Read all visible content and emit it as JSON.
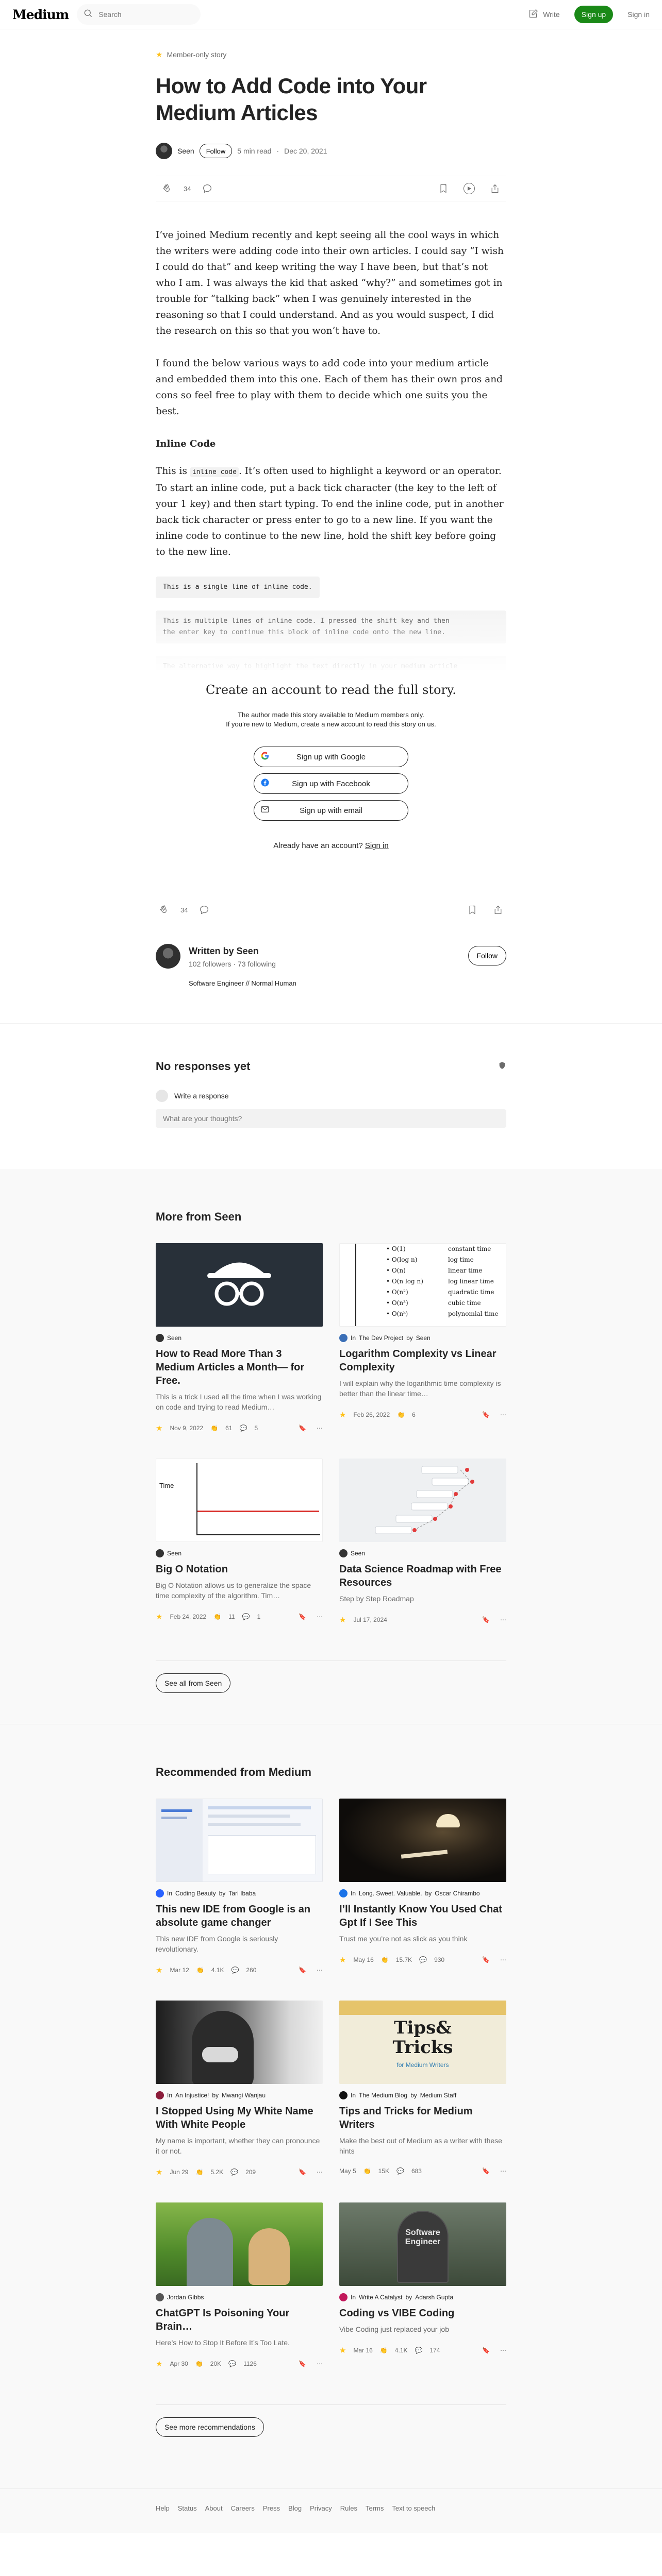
{
  "nav": {
    "logo": "Medium",
    "search_placeholder": "Search",
    "write": "Write",
    "signup": "Sign up",
    "signin": "Sign in"
  },
  "article": {
    "member_only": "Member-only story",
    "title": "How to Add Code into Your Medium Articles",
    "author": "Seen",
    "follow": "Follow",
    "read_time": "5 min read",
    "dot": "·",
    "date": "Dec 20, 2021",
    "claps": "34",
    "p1": "I’ve joined Medium recently and kept seeing all the cool ways in which the writers were adding code into their own articles. I could say “I wish I could do that” and keep writing the way I have been, but that’s not who I am. I was always the kid that asked “why?” and sometimes got in trouble for “talking back” when I was genuinely interested in the reasoning so that I could understand. And as you would suspect, I did the research on this so that you won’t have to.",
    "p2": "I found the below various ways to add code into your medium article and embedded them into this one. Each of them has their own pros and cons so feel free to play with them to decide which one suits you the best.",
    "h_inline": "Inline Code",
    "p3_a": "This is ",
    "p3_code": "inline code",
    "p3_b": ". It’s often used to highlight a keyword or an operator. To start an inline code, put a back tick character (the key to the left of your 1 key) and then start typing. To end the inline code, put in another back tick character or press enter to go to a new line. If you want the inline code to continue to the new line, hold the shift key before going to the new line.",
    "code1": "This is a single line of inline code.",
    "code2a": "This is multiple lines of inline code. I pressed the shift key and then",
    "code2b": "the enter key to continue this block of inline code onto the new line.",
    "code3": "The alternative way to highlight the text directly in your medium article"
  },
  "paywall": {
    "title": "Create an account to read the full story.",
    "sub1": "The author made this story available to Medium members only.",
    "sub2": "If you’re new to Medium, create a new account to read this story on us.",
    "google": "Sign up with Google",
    "facebook": "Sign up with Facebook",
    "email": "Sign up with email",
    "have": "Already have an account?",
    "signin": "Sign in"
  },
  "author_box": {
    "written_by": "Written by Seen",
    "followers": "102 followers",
    "following": "73 following",
    "bio": "Software Engineer // Normal Human",
    "follow": "Follow"
  },
  "responses": {
    "title": "No responses yet",
    "user": "Write a response",
    "placeholder": "What are your thoughts?"
  },
  "more": {
    "title": "More from Seen",
    "cards": [
      {
        "pub": "",
        "in": "",
        "author": "Seen",
        "title": "How to Read More Than 3 Medium Articles a Month— for Free.",
        "desc": "This is a trick I used all the time when I was working on code and trying to read Medium…",
        "date": "Nov 9, 2022",
        "claps": "61",
        "comments": "5"
      },
      {
        "pub": "The Dev Project",
        "in": "In",
        "by": "by",
        "author": "Seen",
        "title": "Logarithm Complexity vs Linear Complexity",
        "desc": "I will explain why the logarithmic time complexity is better than the linear time…",
        "date": "Feb 26, 2022",
        "claps": "6",
        "comments": ""
      },
      {
        "pub": "",
        "in": "",
        "author": "Seen",
        "title": "Big O Notation",
        "desc": "Big O Notation allows us to generalize the space time complexity of the algorithm. Tim…",
        "date": "Feb 24, 2022",
        "claps": "11",
        "comments": "1"
      },
      {
        "pub": "",
        "in": "",
        "author": "Seen",
        "title": "Data Science Roadmap with Free Resources",
        "desc": "Step by Step Roadmap",
        "date": "Jul 17, 2024",
        "claps": "",
        "comments": ""
      }
    ],
    "see_all": "See all from Seen"
  },
  "recommended": {
    "title": "Recommended from Medium",
    "cards": [
      {
        "in": "In",
        "pub": "Coding Beauty",
        "by": "by",
        "author": "Tari Ibaba",
        "title": "This new IDE from Google is an absolute game changer",
        "desc": "This new IDE from Google is seriously revolutionary.",
        "date": "Mar 12",
        "claps": "4.1K",
        "comments": "260"
      },
      {
        "in": "In",
        "pub": "Long. Sweet. Valuable.",
        "by": "by",
        "author": "Oscar Chirambo",
        "title": "I’ll Instantly Know You Used Chat Gpt If I See This",
        "desc": "Trust me you’re not as slick as you think",
        "date": "May 16",
        "claps": "15.7K",
        "comments": "930"
      },
      {
        "in": "In",
        "pub": "An Injustice!",
        "by": "by",
        "author": "Mwangi Wanjau",
        "title": "I Stopped Using My White Name With White People",
        "desc": "My name is important, whether they can pronounce it or not.",
        "date": "Jun 29",
        "claps": "5.2K",
        "comments": "209"
      },
      {
        "in": "In",
        "pub": "The Medium Blog",
        "by": "by",
        "author": "Medium Staff",
        "title": "Tips and Tricks for Medium Writers",
        "desc": "Make the best out of Medium as a writer with these hints",
        "date": "May 5",
        "claps": "15K",
        "comments": "683"
      },
      {
        "in": "",
        "pub": "",
        "by": "",
        "author": "Jordan Gibbs",
        "title": "ChatGPT Is Poisoning Your Brain…",
        "desc": "Here’s How to Stop It Before It’s Too Late.",
        "date": "Apr 30",
        "claps": "20K",
        "comments": "1126"
      },
      {
        "in": "In",
        "pub": "Write A Catalyst",
        "by": "by",
        "author": "Adarsh Gupta",
        "title": "Coding vs VIBE Coding",
        "desc": "Vibe Coding just replaced your job",
        "date": "Mar 16",
        "claps": "4.1K",
        "comments": "174"
      }
    ],
    "see_more": "See more recommendations"
  },
  "img_text": {
    "time": "Time",
    "tips1": "Tips&",
    "tips2": "Tricks",
    "tips3": "for Medium Writers",
    "sw1": "Software",
    "sw2": "Engineer",
    "complexity": [
      [
        "O(1)",
        "constant time"
      ],
      [
        "O(log n)",
        "log time"
      ],
      [
        "O(n)",
        "linear time"
      ],
      [
        "O(n log n)",
        "log linear time"
      ],
      [
        "O(n²)",
        "quadratic time"
      ],
      [
        "O(n³)",
        "cubic time"
      ],
      [
        "O(nᵏ)",
        "polynomial time"
      ]
    ]
  },
  "footer": {
    "links": [
      "Help",
      "Status",
      "About",
      "Careers",
      "Press",
      "Blog",
      "Privacy",
      "Rules",
      "Terms",
      "Text to speech"
    ]
  }
}
